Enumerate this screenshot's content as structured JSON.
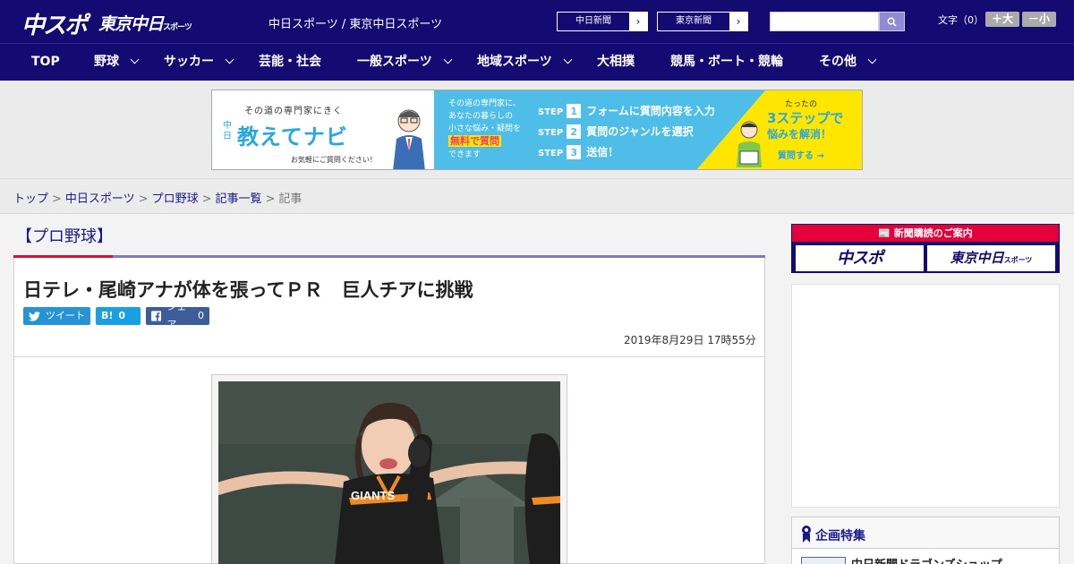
{
  "header": {
    "logo_main": "中スポ",
    "logo_tokyo": "東京中日",
    "logo_tokyo_sub": "スポーツ",
    "site_title": "中日スポーツ / 東京中日スポーツ",
    "papers": [
      {
        "label": "中日新聞"
      },
      {
        "label": "東京新聞"
      }
    ],
    "search_placeholder": "",
    "font_size_label": "文字（0）",
    "font_larger": "＋大",
    "font_smaller": "－小"
  },
  "nav": {
    "items": [
      {
        "label": "TOP",
        "dropdown": false
      },
      {
        "label": "野球",
        "dropdown": true
      },
      {
        "label": "サッカー",
        "dropdown": true
      },
      {
        "label": "芸能・社会",
        "dropdown": false
      },
      {
        "label": "一般スポーツ",
        "dropdown": true
      },
      {
        "label": "地域スポーツ",
        "dropdown": true
      },
      {
        "label": "大相撲",
        "dropdown": false
      },
      {
        "label": "競馬・ボート・競輪",
        "dropdown": false
      },
      {
        "label": "その他",
        "dropdown": true
      }
    ]
  },
  "banner": {
    "tagline": "その道の専門家にきく",
    "brand_small": "中日",
    "brand": "教えてナビ",
    "note": "お気軽にご質問ください！",
    "mid_line1": "その道の専門家に、",
    "mid_line2": "あなたの暮らしの",
    "mid_line3": "小さな悩み・疑問を",
    "mid_highlight": "無料で質問",
    "mid_line4": "できます",
    "steps": [
      {
        "step": "STEP",
        "num": "1",
        "text": "フォームに質問内容を入力"
      },
      {
        "step": "STEP",
        "num": "2",
        "text": "質問のジャンルを選択"
      },
      {
        "step": "STEP",
        "num": "3",
        "text": "送信！"
      }
    ],
    "right_small": "たったの",
    "right_big": "3ステップで",
    "right_mid": "悩みを解消！",
    "right_cta": "質問する →"
  },
  "breadcrumb": {
    "items": [
      "トップ",
      "中日スポーツ",
      "プロ野球",
      "記事一覧"
    ],
    "current": "記事",
    "separator": ">"
  },
  "article": {
    "category": "【プロ野球】",
    "headline": "日テレ・尾崎アナが体を張ってＰＲ　巨人チアに挑戦",
    "share_tweet": "ツイート",
    "share_hatena_icon": "B!",
    "share_hatena_count": "0",
    "share_fb": "シェア",
    "share_fb_count": "0",
    "date": "2019年8月29日 17時55分",
    "photo_jersey_text": "GIANTS"
  },
  "sidebar": {
    "subscribe_head": "新聞購読のご案内",
    "subscribe_chuspo": "中スポ",
    "subscribe_tokyo": "東京中日",
    "subscribe_tokyo_sub": "スポーツ",
    "feature_title": "企画特集",
    "feature_item": "中日新聞ドラゴンズショップ"
  },
  "colors": {
    "brand_navy": "#130a72",
    "accent_red": "#d70f32",
    "twitter": "#2593d5",
    "hatena": "#18a0e3",
    "facebook": "#3d5c9a"
  }
}
